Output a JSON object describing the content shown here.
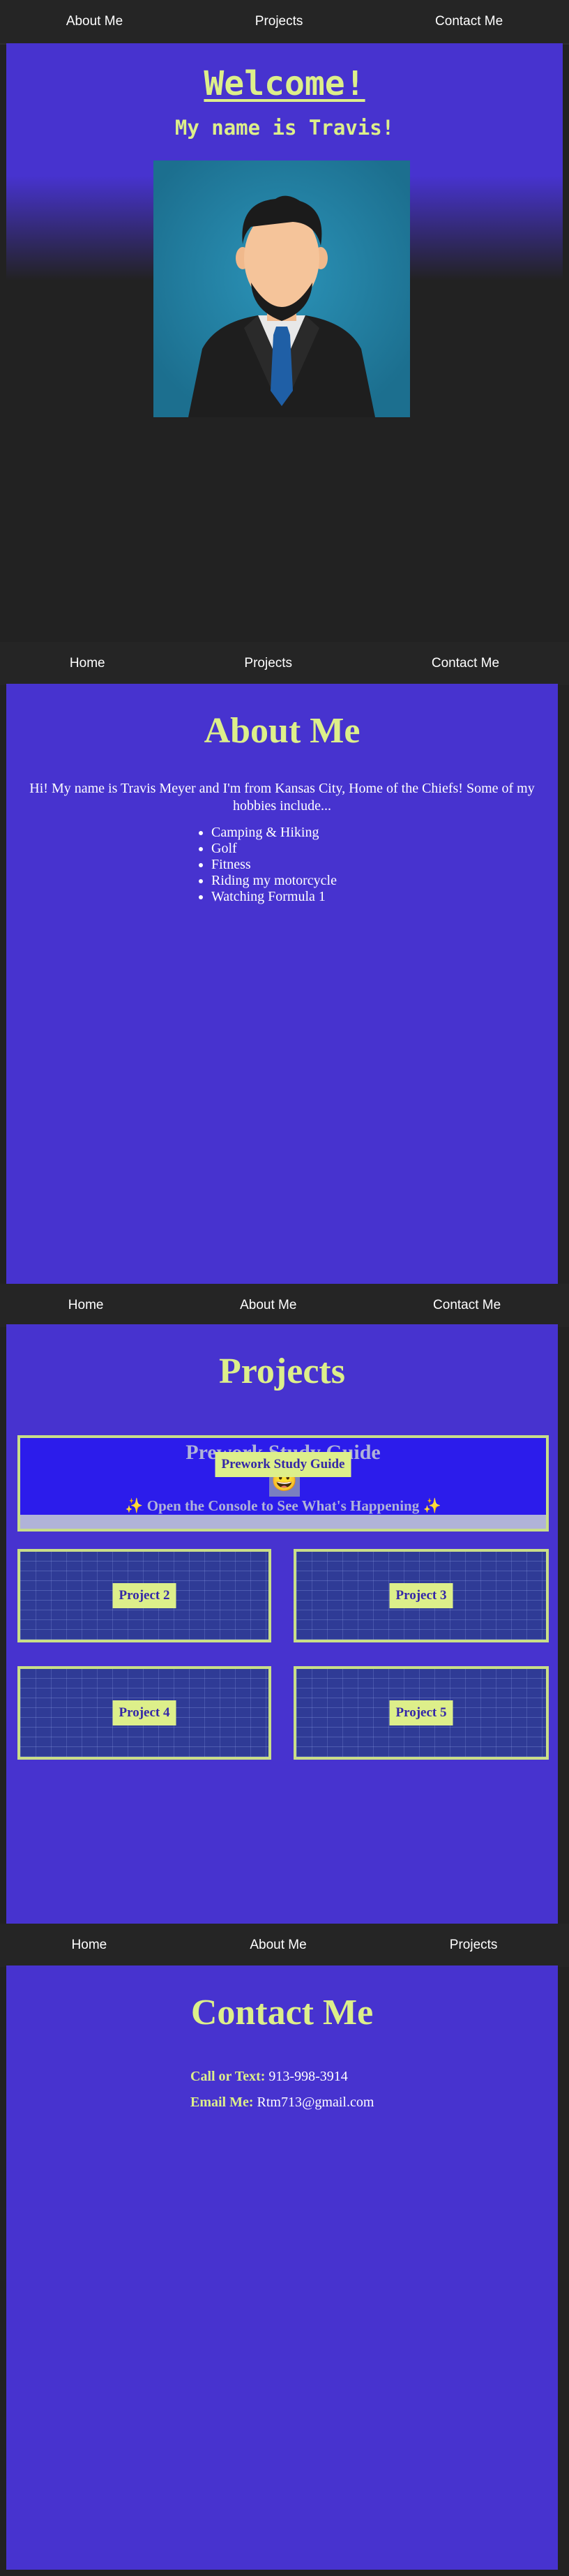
{
  "nav": [
    {
      "items": [
        "About Me",
        "Projects",
        "Contact Me"
      ]
    },
    {
      "items": [
        "Home",
        "Projects",
        "Contact Me"
      ]
    },
    {
      "items": [
        "Home",
        "About Me",
        "Contact Me"
      ]
    },
    {
      "items": [
        "Home",
        "About Me",
        "Projects"
      ]
    }
  ],
  "hero": {
    "title": "Welcome!",
    "subtitle": "My name is Travis!"
  },
  "about": {
    "title": "About Me",
    "intro": "Hi! My name is Travis Meyer and I'm from Kansas City, Home of the Chiefs! Some of my hobbies include...",
    "hobbies": [
      "Camping & Hiking",
      "Golf",
      "Fitness",
      "Riding my motorcycle",
      "Watching Formula 1"
    ]
  },
  "projects": {
    "title": "Projects",
    "featured": {
      "label": "Prework Study Guide",
      "title": "Prework Study Guide",
      "emoji": "😀",
      "console_text": "✨ Open the Console to See What's Happening ✨"
    },
    "items": [
      "Project 2",
      "Project 3",
      "Project 4",
      "Project 5"
    ]
  },
  "contact": {
    "title": "Contact Me",
    "phone_label": "Call or Text:",
    "phone": "913-998-3914",
    "email_label": "Email Me:",
    "email": "Rtm713@gmail.com"
  },
  "colors": {
    "accent": "#ddef8a",
    "section_bg": "#4733cf",
    "page_bg": "#222222",
    "featured_bg": "#2c1ceb"
  },
  "icons": [
    "person-avatar"
  ]
}
